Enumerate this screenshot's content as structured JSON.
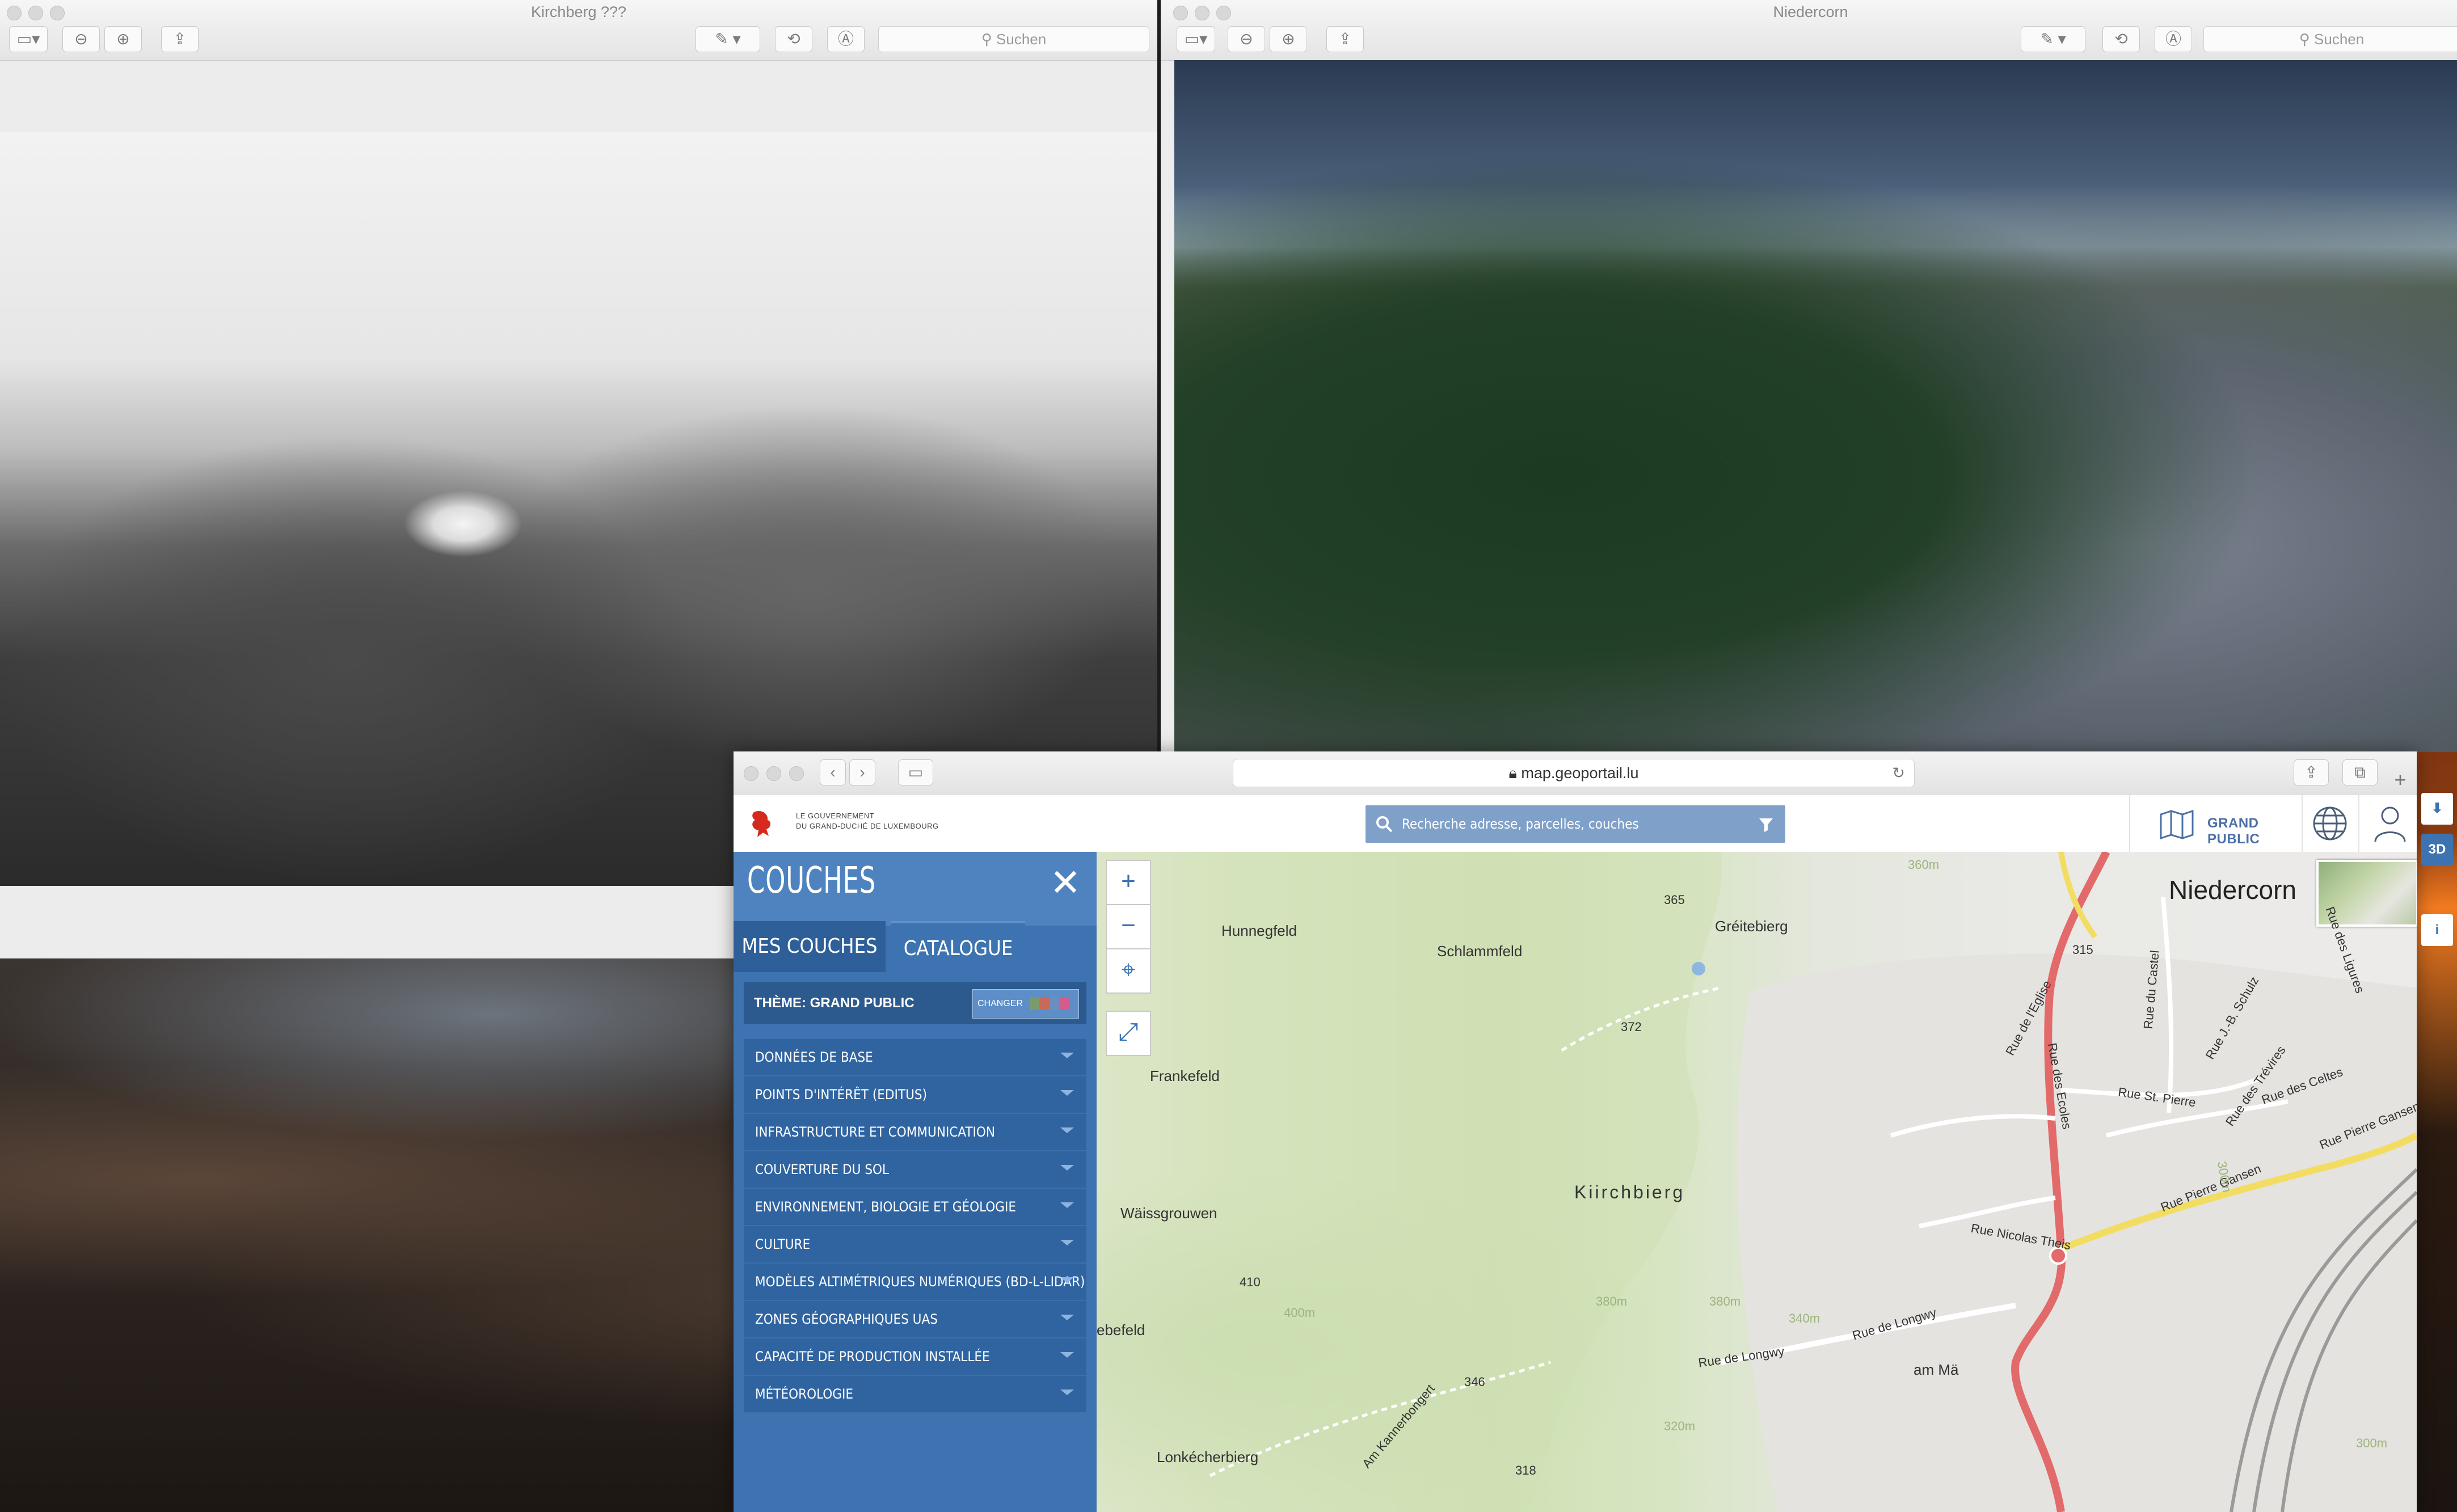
{
  "preview_left": {
    "title": "Kirchberg ???",
    "search_placeholder": "Suchen"
  },
  "preview_right": {
    "title": "Niedercorn",
    "search_placeholder": "Suchen"
  },
  "safari": {
    "url": "map.geoportail.lu"
  },
  "header": {
    "gov_line1": "LE GOUVERNEMENT",
    "gov_line2": "DU GRAND-DUCHÉ DE LUXEMBOURG",
    "search_placeholder": "Recherche adresse, parcelles, couches",
    "theme_button": "GRAND PUBLIC"
  },
  "layers_panel": {
    "title": "COUCHES",
    "tab_mine": "MES COUCHES",
    "tab_catalog": "CATALOGUE",
    "theme_label": "THÈME: GRAND PUBLIC",
    "change_label": "CHANGER",
    "categories": [
      "DONNÉES DE BASE",
      "POINTS D'INTÉRÊT (EDITUS)",
      "INFRASTRUCTURE ET COMMUNICATION",
      "COUVERTURE DU SOL",
      "ENVIRONNEMENT, BIOLOGIE ET GÉOLOGIE",
      "CULTURE",
      "MODÈLES ALTIMÉTRIQUES NUMÉRIQUES (BD-L-LIDAR)",
      "ZONES GÉOGRAPHIQUES UAS",
      "CAPACITÉ DE PRODUCTION INSTALLÉE",
      "MÉTÉOROLOGIE"
    ]
  },
  "map": {
    "places": {
      "niedercorn": "Niedercorn",
      "hunnegfeld": "Hunnegfeld",
      "schlammfeld": "Schlammfeld",
      "greitebierg": "Gréitebierg",
      "frankefeld": "Frankefeld",
      "kiirchbierg": "Kiirchbierg",
      "waissgrouwen": "Wäissgrouwen",
      "ebefeld": "ebefeld",
      "am_ma": "am Mä",
      "lonkecherbierg": "Lonkécherbierg"
    },
    "streets": {
      "rue_eglise": "Rue de l'Eglise",
      "rue_ecoles": "Rue des Ecoles",
      "rue_castel": "Rue du Castel",
      "rue_st_pierre": "Rue St. Pierre",
      "rue_nicolas_theis": "Rue Nicolas Theis",
      "rue_pierre_gansen": "Rue Pierre Gansen",
      "rue_de_longwy": "Rue de Longwy",
      "rue_celtes": "Rue des Celtes",
      "rue_ligures": "Rue des Ligures",
      "rue_treveres": "Rue des Trévires",
      "am_kannerbongert": "Am Kannerbongert",
      "rue_b_schulz": "Rue J.-B. Schulz"
    },
    "elevations": {
      "e365": "365",
      "e315": "315",
      "e372": "372",
      "e410": "410",
      "e346": "346",
      "e318": "318",
      "c360": "360m",
      "c380": "380m",
      "c400": "400m",
      "c340": "340m",
      "c320": "320m",
      "c300": "300m"
    },
    "side_3d": "3D"
  }
}
